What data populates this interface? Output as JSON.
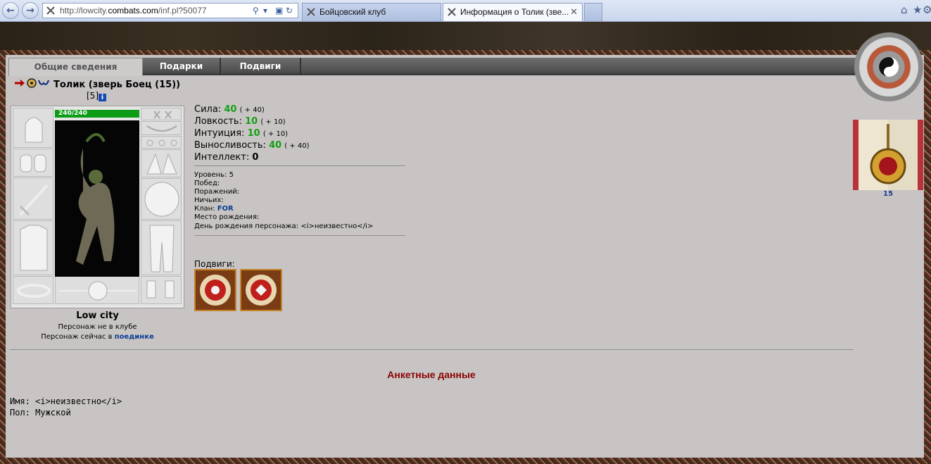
{
  "browser": {
    "url_prefix": "http://lowcity.",
    "url_domain": "combats.com",
    "url_path": "/inf.pl?50077",
    "tabs": [
      {
        "label": "Бойцовский клуб",
        "active": false
      },
      {
        "label": "Информация о Толик (зве...",
        "active": true
      }
    ]
  },
  "page_tabs": [
    {
      "label": "Общие сведения",
      "active": true
    },
    {
      "label": "Подарки",
      "active": false
    },
    {
      "label": "Подвиги",
      "active": false
    }
  ],
  "character": {
    "name": "Толик (зверь Боец (15))",
    "level_tag": "[5]",
    "info_icon": "i",
    "hp": "240/240",
    "city": "Low city",
    "club_status": "Персонаж не в клубе",
    "location_prefix": "Персонаж сейчас в ",
    "location_link": "поединке"
  },
  "stats": [
    {
      "label": "Сила:",
      "value": "40",
      "bonus": "( + 40)"
    },
    {
      "label": "Ловкость:",
      "value": "10",
      "bonus": "( + 10)"
    },
    {
      "label": "Интуиция:",
      "value": "10",
      "bonus": "( + 10)"
    },
    {
      "label": "Выносливость:",
      "value": "40",
      "bonus": "( + 40)"
    },
    {
      "label": "Интеллект:",
      "value": "0",
      "bonus": ""
    }
  ],
  "info": {
    "level": "Уровень: 5",
    "wins": "Побед:",
    "losses": "Поражений:",
    "draws": "Ничьих:",
    "clan_label": "Клан: ",
    "clan_value": "FOR",
    "birthplace": "Место рождения:",
    "birthday": "День рождения персонажа: <i>неизвестно</i>"
  },
  "achievements": {
    "title": "Подвиги:"
  },
  "anketa": {
    "title": "Анкетные данные",
    "name": "Имя: <i>неизвестно</i>",
    "gender": "Пол: Мужской"
  },
  "side": {
    "book_number": "15"
  },
  "colors": {
    "stat_value": "#16a016",
    "link": "#0b3d91",
    "anketa_title": "#8b0000",
    "hp_bar": "#0c9c16"
  }
}
